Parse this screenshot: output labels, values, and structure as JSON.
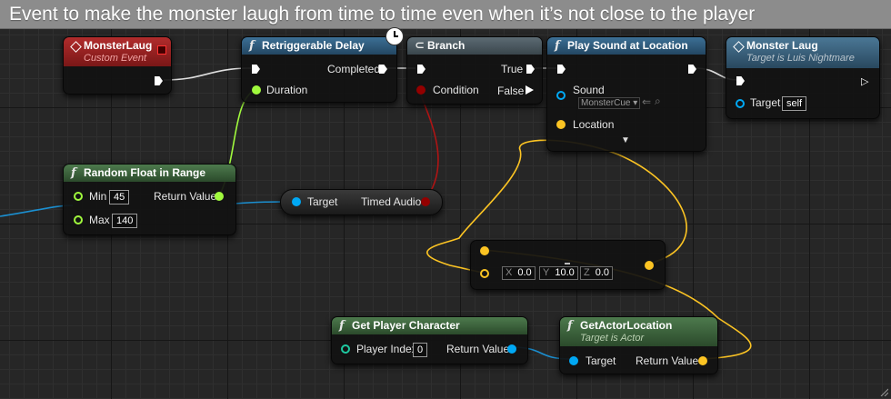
{
  "comment": {
    "title": "Event to make the monster laugh from time to time even when it’s not close to the player"
  },
  "colors": {
    "exec": "#ffffff",
    "float": "#a0f93d",
    "object": "#00a8f4",
    "vector": "#fcc423",
    "bool": "#930000"
  },
  "nodes": {
    "custom_event": {
      "title": "MonsterLaug",
      "subtitle": "Custom Event"
    },
    "delay": {
      "title": "Retriggerable Delay",
      "completed": "Completed",
      "duration": "Duration"
    },
    "branch": {
      "title": "Branch",
      "true_label": "True",
      "false_label": "False",
      "condition": "Condition"
    },
    "play_sound": {
      "title": "Play Sound at Location",
      "sound": "Sound",
      "sound_value": "MonsterCue",
      "location": "Location"
    },
    "monster_laug": {
      "title": "Monster Laug",
      "subtitle": "Target is Luis Nightmare",
      "target": "Target",
      "target_value": "self"
    },
    "random_float": {
      "title": "Random Float in Range",
      "min": "Min",
      "min_value": "45",
      "max": "Max",
      "max_value": "140",
      "return": "Return Value"
    },
    "timed_audio": {
      "target": "Target",
      "output": "Timed Audio"
    },
    "make_vector": {
      "x_label": "X",
      "x": "0.0",
      "y_label": "Y",
      "y": "10.0",
      "z_label": "Z",
      "z": "0.0"
    },
    "get_player": {
      "title": "Get Player Character",
      "player_index": "Player Index",
      "index_value": "0",
      "return": "Return Value"
    },
    "actor_location": {
      "title": "GetActorLocation",
      "subtitle": "Target is Actor",
      "target": "Target",
      "return": "Return Value"
    }
  }
}
